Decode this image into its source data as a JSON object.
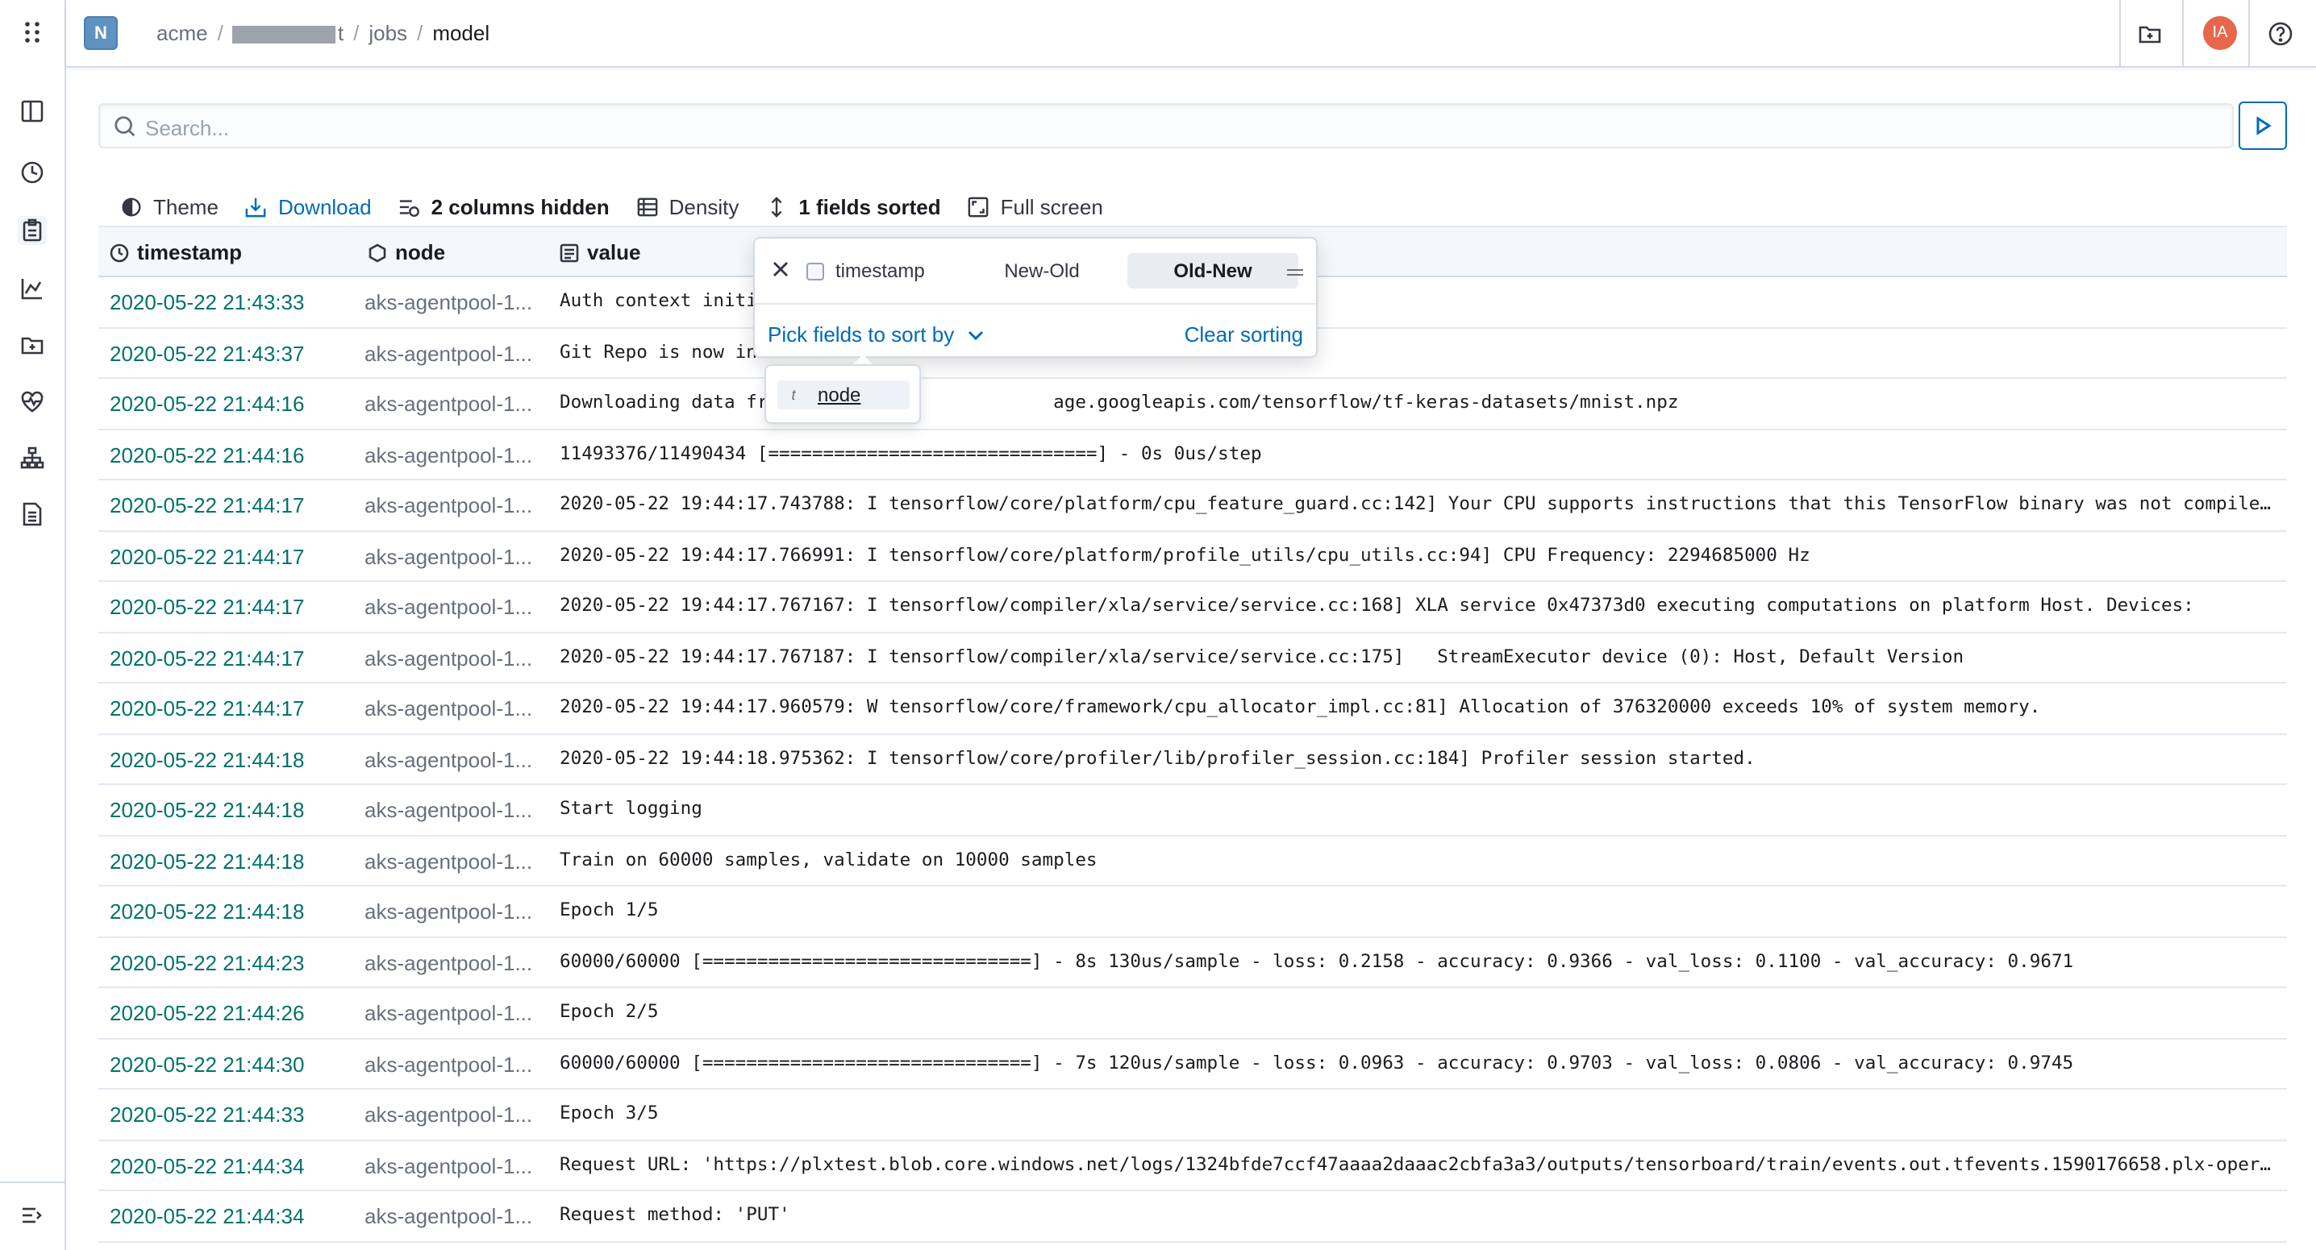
{
  "breadcrumb": {
    "project_badge": "N",
    "items": [
      "acme",
      "t",
      "jobs",
      "model"
    ]
  },
  "user": {
    "initials": "IA",
    "avatar_color": "#e7664c"
  },
  "search": {
    "placeholder": "Search...",
    "value": ""
  },
  "toolbar": {
    "theme": "Theme",
    "download": "Download",
    "columns_hidden": "2 columns hidden",
    "density": "Density",
    "fields_sorted": "1 fields sorted",
    "full_screen": "Full screen"
  },
  "columns": {
    "timestamp": "timestamp",
    "node": "node",
    "value": "value"
  },
  "sort_popover": {
    "field": "timestamp",
    "option_new_old": "New-Old",
    "option_old_new": "Old-New",
    "selected": "Old-New",
    "pick_fields": "Pick fields to sort by",
    "clear": "Clear sorting",
    "available_field_type": "t",
    "available_field": "node"
  },
  "rows": [
    {
      "timestamp": "2020-05-22 21:43:33",
      "node": "aks-agentpool-1...",
      "value": "Auth context initi"
    },
    {
      "timestamp": "2020-05-22 21:43:37",
      "node": "aks-agentpool-1...",
      "value": "Git Repo is now in"
    },
    {
      "timestamp": "2020-05-22 21:44:16",
      "node": "aks-agentpool-1...",
      "value": "Downloading data fr                          age.googleapis.com/tensorflow/tf-keras-datasets/mnist.npz"
    },
    {
      "timestamp": "2020-05-22 21:44:16",
      "node": "aks-agentpool-1...",
      "value": "11493376/11490434 [==============================] - 0s 0us/step"
    },
    {
      "timestamp": "2020-05-22 21:44:17",
      "node": "aks-agentpool-1...",
      "value": "2020-05-22 19:44:17.743788: I tensorflow/core/platform/cpu_feature_guard.cc:142] Your CPU supports instructions that this TensorFlow binary was not compiled t..."
    },
    {
      "timestamp": "2020-05-22 21:44:17",
      "node": "aks-agentpool-1...",
      "value": "2020-05-22 19:44:17.766991: I tensorflow/core/platform/profile_utils/cpu_utils.cc:94] CPU Frequency: 2294685000 Hz"
    },
    {
      "timestamp": "2020-05-22 21:44:17",
      "node": "aks-agentpool-1...",
      "value": "2020-05-22 19:44:17.767167: I tensorflow/compiler/xla/service/service.cc:168] XLA service 0x47373d0 executing computations on platform Host. Devices:"
    },
    {
      "timestamp": "2020-05-22 21:44:17",
      "node": "aks-agentpool-1...",
      "value": "2020-05-22 19:44:17.767187: I tensorflow/compiler/xla/service/service.cc:175]   StreamExecutor device (0): Host, Default Version"
    },
    {
      "timestamp": "2020-05-22 21:44:17",
      "node": "aks-agentpool-1...",
      "value": "2020-05-22 19:44:17.960579: W tensorflow/core/framework/cpu_allocator_impl.cc:81] Allocation of 376320000 exceeds 10% of system memory."
    },
    {
      "timestamp": "2020-05-22 21:44:18",
      "node": "aks-agentpool-1...",
      "value": "2020-05-22 19:44:18.975362: I tensorflow/core/profiler/lib/profiler_session.cc:184] Profiler session started."
    },
    {
      "timestamp": "2020-05-22 21:44:18",
      "node": "aks-agentpool-1...",
      "value": "Start logging"
    },
    {
      "timestamp": "2020-05-22 21:44:18",
      "node": "aks-agentpool-1...",
      "value": "Train on 60000 samples, validate on 10000 samples"
    },
    {
      "timestamp": "2020-05-22 21:44:18",
      "node": "aks-agentpool-1...",
      "value": "Epoch 1/5"
    },
    {
      "timestamp": "2020-05-22 21:44:23",
      "node": "aks-agentpool-1...",
      "value": "60000/60000 [==============================] - 8s 130us/sample - loss: 0.2158 - accuracy: 0.9366 - val_loss: 0.1100 - val_accuracy: 0.9671"
    },
    {
      "timestamp": "2020-05-22 21:44:26",
      "node": "aks-agentpool-1...",
      "value": "Epoch 2/5"
    },
    {
      "timestamp": "2020-05-22 21:44:30",
      "node": "aks-agentpool-1...",
      "value": "60000/60000 [==============================] - 7s 120us/sample - loss: 0.0963 - accuracy: 0.9703 - val_loss: 0.0806 - val_accuracy: 0.9745"
    },
    {
      "timestamp": "2020-05-22 21:44:33",
      "node": "aks-agentpool-1...",
      "value": "Epoch 3/5"
    },
    {
      "timestamp": "2020-05-22 21:44:34",
      "node": "aks-agentpool-1...",
      "value": "Request URL: 'https://plxtest.blob.core.windows.net/logs/1324bfde7ccf47aaaa2daaac2cbfa3a3/outputs/tensorboard/train/events.out.tfevents.1590176658.plx-operati..."
    },
    {
      "timestamp": "2020-05-22 21:44:34",
      "node": "aks-agentpool-1...",
      "value": "Request method: 'PUT'"
    }
  ],
  "colors": {
    "link": "#006bb8",
    "timestamp": "#00726b",
    "badge": "#6092c0"
  }
}
